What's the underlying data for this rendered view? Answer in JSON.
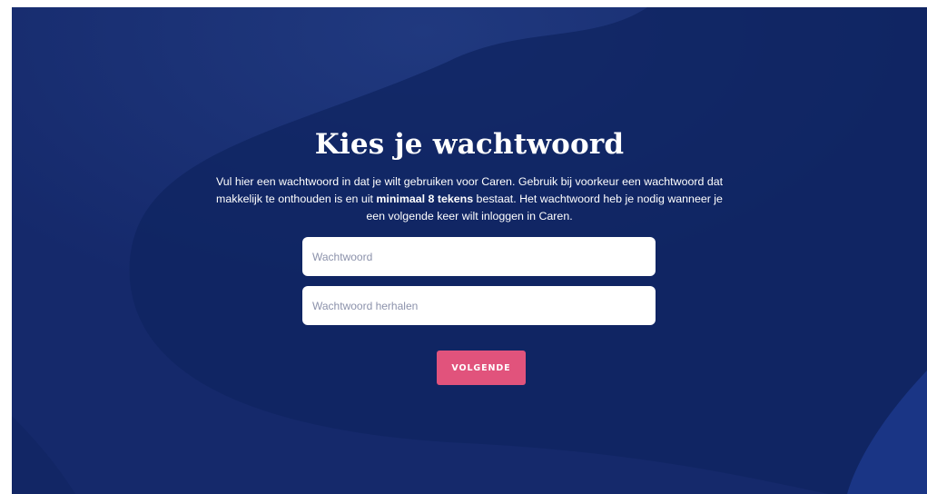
{
  "colors": {
    "background": "#13296a",
    "shape_dark": "#102360",
    "shape_light": "#1b3580",
    "button": "#e1537c",
    "text": "#ffffff",
    "placeholder": "#8c92ab"
  },
  "page": {
    "title": "Kies je wachtwoord",
    "intro_part1": "Vul hier een wachtwoord in dat je wilt gebruiken voor Caren. Gebruik bij voorkeur een wachtwoord dat makkelijk te onthouden is en uit ",
    "intro_bold": "minimaal 8 tekens",
    "intro_part2": " bestaat. Het wachtwoord heb je nodig wanneer je een volgende keer wilt inloggen in Caren."
  },
  "form": {
    "password_placeholder": "Wachtwoord",
    "password_value": "",
    "repeat_placeholder": "Wachtwoord herhalen",
    "repeat_value": "",
    "next_button_label": "VOLGENDE"
  }
}
